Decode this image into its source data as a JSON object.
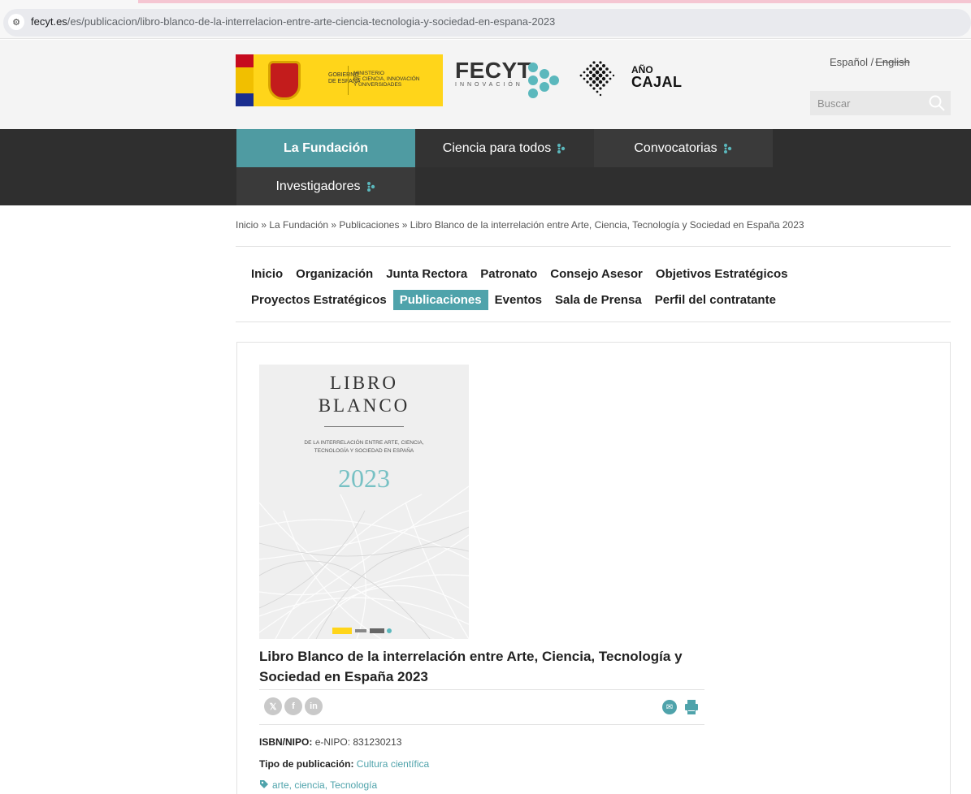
{
  "browser": {
    "url_host": "fecyt.es",
    "url_path": "/es/publicacion/libro-blanco-de-la-interrelacion-entre-arte-ciencia-tecnologia-y-sociedad-en-espana-2023"
  },
  "header": {
    "gov_logo": {
      "line1": "GOBIERNO",
      "line2": "DE ESPAÑA",
      "ministry1": "MINISTERIO",
      "ministry2": "DE CIENCIA, INNOVACIÓN",
      "ministry3": "Y UNIVERSIDADES"
    },
    "fecyt_logo": {
      "word": "FECYT",
      "sub": "INNOVACIÓN"
    },
    "cajal_logo": {
      "ano": "AÑO",
      "cajal": "CAJAL"
    },
    "lang_es": "Español /",
    "lang_en": "English",
    "search_placeholder": "Buscar"
  },
  "mainnav": {
    "items": [
      {
        "label": "La Fundación"
      },
      {
        "label": "Ciencia para todos"
      },
      {
        "label": "Convocatorias"
      },
      {
        "label": "Investigadores"
      }
    ],
    "accent": "#4f9ba2"
  },
  "breadcrumb": "Inicio » La Fundación » Publicaciones » Libro Blanco de la interrelación entre Arte, Ciencia, Tecnología y Sociedad en España 2023",
  "subnav": {
    "row1": [
      "Inicio",
      "Organización",
      "Junta Rectora",
      "Patronato",
      "Consejo Asesor",
      "Objetivos Estratégicos"
    ],
    "row2": [
      "Proyectos Estratégicos",
      "Publicaciones",
      "Eventos",
      "Sala de Prensa",
      "Perfil del contratante"
    ],
    "active": "Publicaciones"
  },
  "publication": {
    "cover": {
      "title1": "LIBRO",
      "title2": "BLANCO",
      "subtitle1": "DE LA INTERRELACIÓN ENTRE ARTE, CIENCIA,",
      "subtitle2": "TECNOLOGÍA Y SOCIEDAD EN ESPAÑA",
      "year": "2023"
    },
    "title": "Libro Blanco de la interrelación entre Arte, Ciencia, Tecnología y Sociedad en España 2023",
    "share_icons": [
      "x-icon",
      "facebook-icon",
      "linkedin-icon"
    ],
    "isbn_label": "ISBN/NIPO:",
    "isbn_value": "e-NIPO: 831230213",
    "tipo_label": "Tipo de publicación:",
    "tipo_value": "Cultura científica",
    "tags": "arte, ciencia, Tecnología"
  }
}
